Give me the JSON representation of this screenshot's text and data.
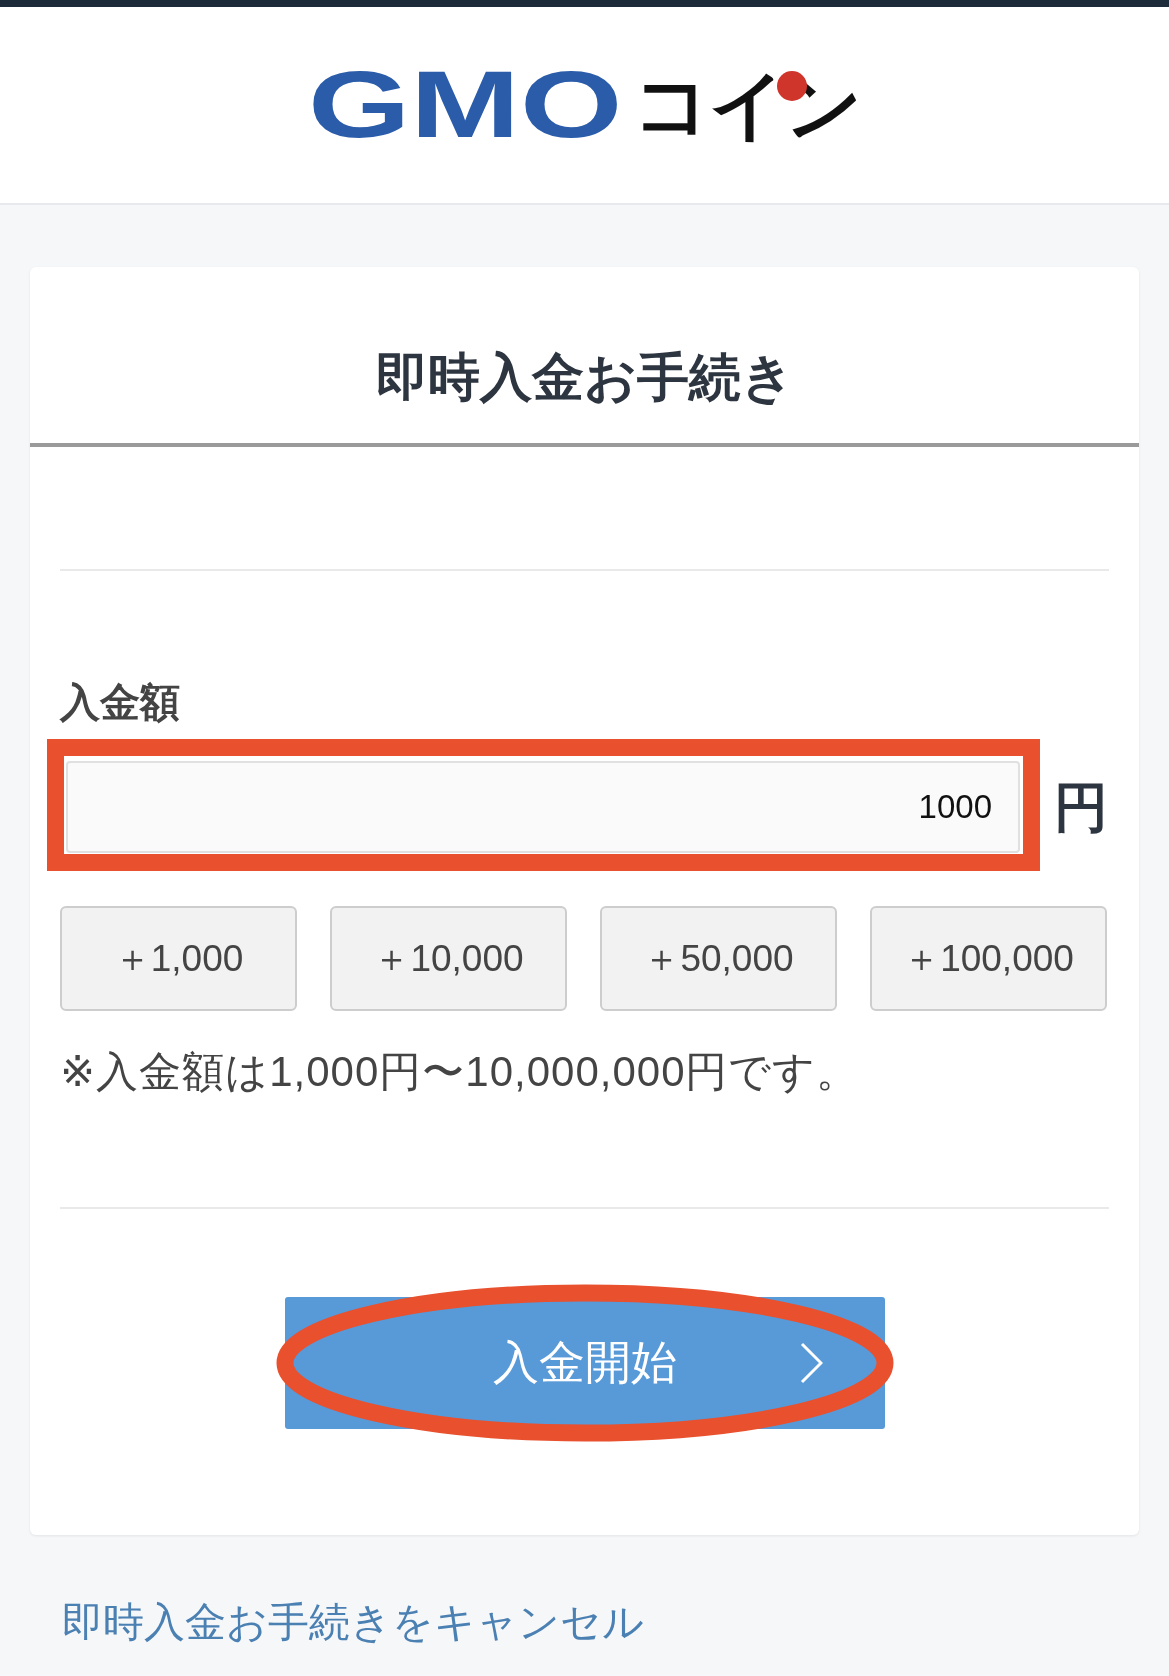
{
  "header": {
    "logo": {
      "brand": "GMO",
      "product": "コイン"
    }
  },
  "card": {
    "title": "即時入金お手続き",
    "amount": {
      "label": "入金額",
      "value": "1000",
      "unit": "円",
      "highlighted": true
    },
    "quick_add_buttons": [
      "＋1,000",
      "＋10,000",
      "＋50,000",
      "＋100,000"
    ],
    "note": "※入金額は1,000円〜10,000,000円です。",
    "start_button": {
      "label": "入金開始",
      "highlighted": true
    }
  },
  "cancel_link": "即時入金お手続きをキャンセル"
}
